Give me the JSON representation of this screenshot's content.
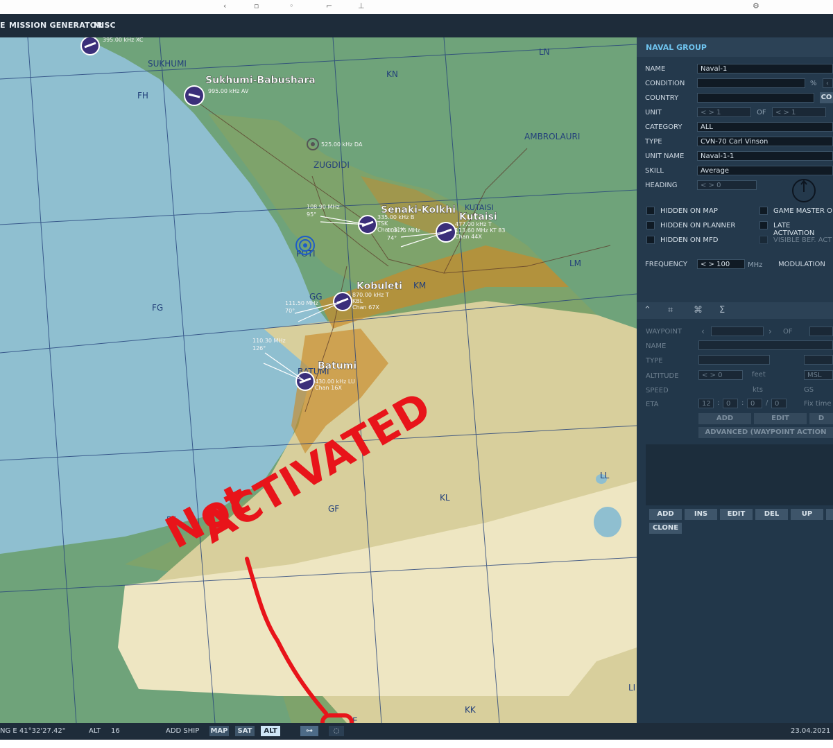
{
  "menu": {
    "items": [
      "E",
      "MISSION GENERATOR",
      "MISC"
    ]
  },
  "map": {
    "cities": [
      "SUKHUMI",
      "ZUGDIDI",
      "AMBROLAURI",
      "KUTAISI",
      "POTI",
      "BATUMI"
    ],
    "grid_labels": [
      "LN",
      "KN",
      "FH",
      "FG",
      "GG",
      "KM",
      "LM",
      "LL",
      "KL",
      "GF",
      "FF",
      "KK",
      "LI",
      "E"
    ],
    "airbases": [
      {
        "name": "Sukhumi-Babushara",
        "freq": "995.00 kHz AV"
      },
      {
        "name": "Senaki-Kolkhi",
        "freq": "335.00 kHz B"
      },
      {
        "name": "Kutaisi",
        "freq": "477.00 kHz T"
      },
      {
        "name": "Kobuleti",
        "freq": "870.00 kHz T"
      },
      {
        "name": "Batumi",
        "freq": "430.00 kHz LU"
      }
    ],
    "ils": [
      {
        "freq": "108.90 MHz",
        "hdg": "95°"
      },
      {
        "freq": "109.75 MHz",
        "hdg": "74°"
      },
      {
        "freq": "111.50 MHz",
        "hdg": "70°"
      },
      {
        "freq": "110.30 MHz",
        "hdg": "126°"
      }
    ],
    "beacons": {
      "b1": "395.00 kHz XC",
      "b2": "525.00 kHz DA",
      "senaki_extra": "TSK",
      "senaki_chan": "Chan 31X",
      "kutaisi_extra": "113.60 MHz KT 83",
      "kutaisi_chan": "Chan 44X",
      "kobuleti_extra": "KBL",
      "kobuleti_chan": "Chan 67X",
      "batumi_chan": "Chan 16X"
    },
    "annotation": {
      "line1": "Not",
      "line2": "ACTIVATED"
    }
  },
  "panel": {
    "title": "NAVAL GROUP",
    "labels": {
      "name": "NAME",
      "condition": "CONDITION",
      "country": "COUNTRY",
      "unit": "UNIT",
      "category": "CATEGORY",
      "type": "TYPE",
      "unit_name": "UNIT NAME",
      "skill": "SKILL",
      "heading": "HEADING",
      "frequency": "FREQUENCY",
      "modulation": "MODULATION",
      "of": "OF"
    },
    "values": {
      "name": "Naval-1",
      "condition_unit": "%",
      "country_btn": "CO",
      "unit_cur": "< > 1",
      "unit_total": "< > 1",
      "category": "ALL",
      "type": "CVN-70 Carl Vinson",
      "unit_name": "Naval-1-1",
      "skill": "Average",
      "heading": "< > 0",
      "frequency": "< > 100",
      "freq_unit": "MHz"
    },
    "checkboxes": [
      "HIDDEN ON MAP",
      "HIDDEN ON PLANNER",
      "HIDDEN ON MFD",
      "GAME MASTER O",
      "LATE ACTIVATION",
      "VISIBLE BEF. ACT"
    ],
    "route": {
      "labels": {
        "waypoint": "WAYPOINT",
        "of": "OF",
        "name": "NAME",
        "type": "TYPE",
        "altitude": "ALTITUDE",
        "speed": "SPEED",
        "eta": "ETA"
      },
      "units": {
        "feet": "feet",
        "kts": "kts",
        "gs": "GS",
        "msl": "MSL",
        "alt_val": "< > 0",
        "fix_time": "Fix time"
      },
      "eta": [
        "12",
        "0",
        "0",
        "0"
      ],
      "buttons": {
        "add": "ADD",
        "edit": "EDIT",
        "del": "D",
        "advanced": "ADVANCED (WAYPOINT ACTION"
      }
    },
    "list_buttons": [
      "ADD",
      "INS",
      "EDIT",
      "DEL",
      "UP",
      "CLONE"
    ]
  },
  "status": {
    "lng": "NG  E 41°32'27.42\"",
    "alt_label": "ALT",
    "alt_value": "16",
    "add_ship": "ADD SHIP",
    "map": "MAP",
    "sat": "SAT",
    "alt_btn": "ALT",
    "date": "23.04.2021"
  }
}
